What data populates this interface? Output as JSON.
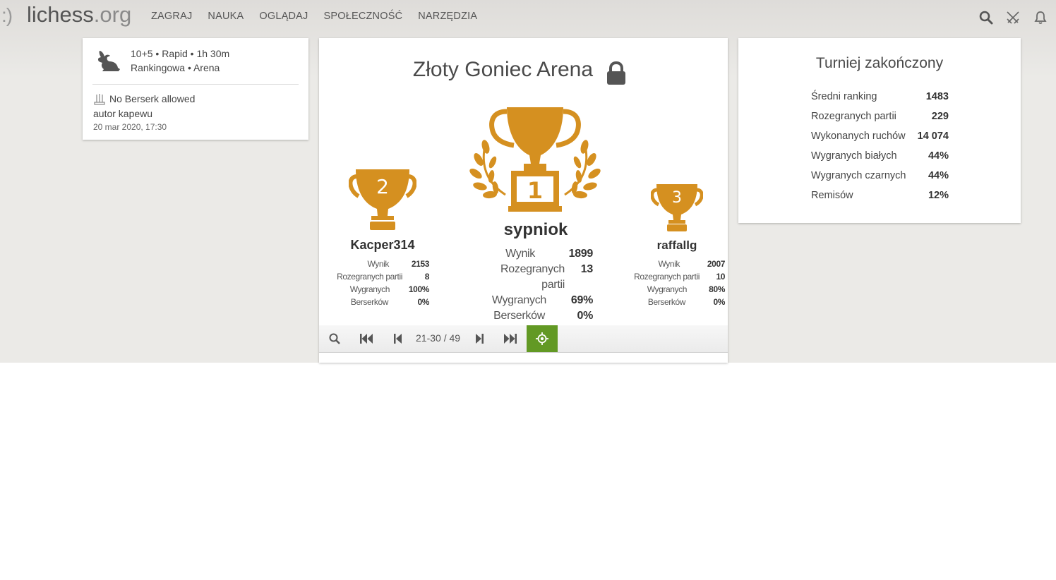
{
  "header": {
    "logo_face": ":)",
    "logo_name": "lichess",
    "logo_tld": ".org",
    "nav": [
      "ZAGRAJ",
      "NAUKA",
      "OGLĄDAJ",
      "SPOŁECZNOŚĆ",
      "NARZĘDZIA"
    ],
    "icons": [
      "search-icon",
      "swords-icon",
      "bell-icon"
    ]
  },
  "info": {
    "line1": "10+5 • Rapid • 1h 30m",
    "line2": "Rankingowa • Arena",
    "berserk": "No Berserk allowed",
    "author": "autor kapewu",
    "date": "20 mar 2020, 17:30"
  },
  "tournament": {
    "title": "Złoty Goniec Arena",
    "podium": [
      {
        "rank": "1",
        "name": "sypniok",
        "stats": [
          [
            "Wynik",
            "1899"
          ],
          [
            "Rozegranych partii",
            "13"
          ],
          [
            "Wygranych",
            "69%"
          ],
          [
            "Berserków",
            "0%"
          ]
        ]
      },
      {
        "rank": "2",
        "name": "Kacper314",
        "stats": [
          [
            "Wynik",
            "2153"
          ],
          [
            "Rozegranych partii",
            "8"
          ],
          [
            "Wygranych",
            "100%"
          ],
          [
            "Berserków",
            "0%"
          ]
        ]
      },
      {
        "rank": "3",
        "name": "raffallg",
        "stats": [
          [
            "Wynik",
            "2007"
          ],
          [
            "Rozegranych partii",
            "10"
          ],
          [
            "Wygranych",
            "80%"
          ],
          [
            "Berserków",
            "0%"
          ]
        ]
      }
    ],
    "pager": "21-30 / 49"
  },
  "summary": {
    "title": "Turniej zakończony",
    "rows": [
      [
        "Średni ranking",
        "1483"
      ],
      [
        "Rozegranych partii",
        "229"
      ],
      [
        "Wykonanych ruchów",
        "14 074"
      ],
      [
        "Wygranych białych",
        "44%"
      ],
      [
        "Wygranych czarnych",
        "44%"
      ],
      [
        "Remisów",
        "12%"
      ]
    ]
  },
  "colors": {
    "trophy": "#d59020",
    "accent": "#629924"
  }
}
